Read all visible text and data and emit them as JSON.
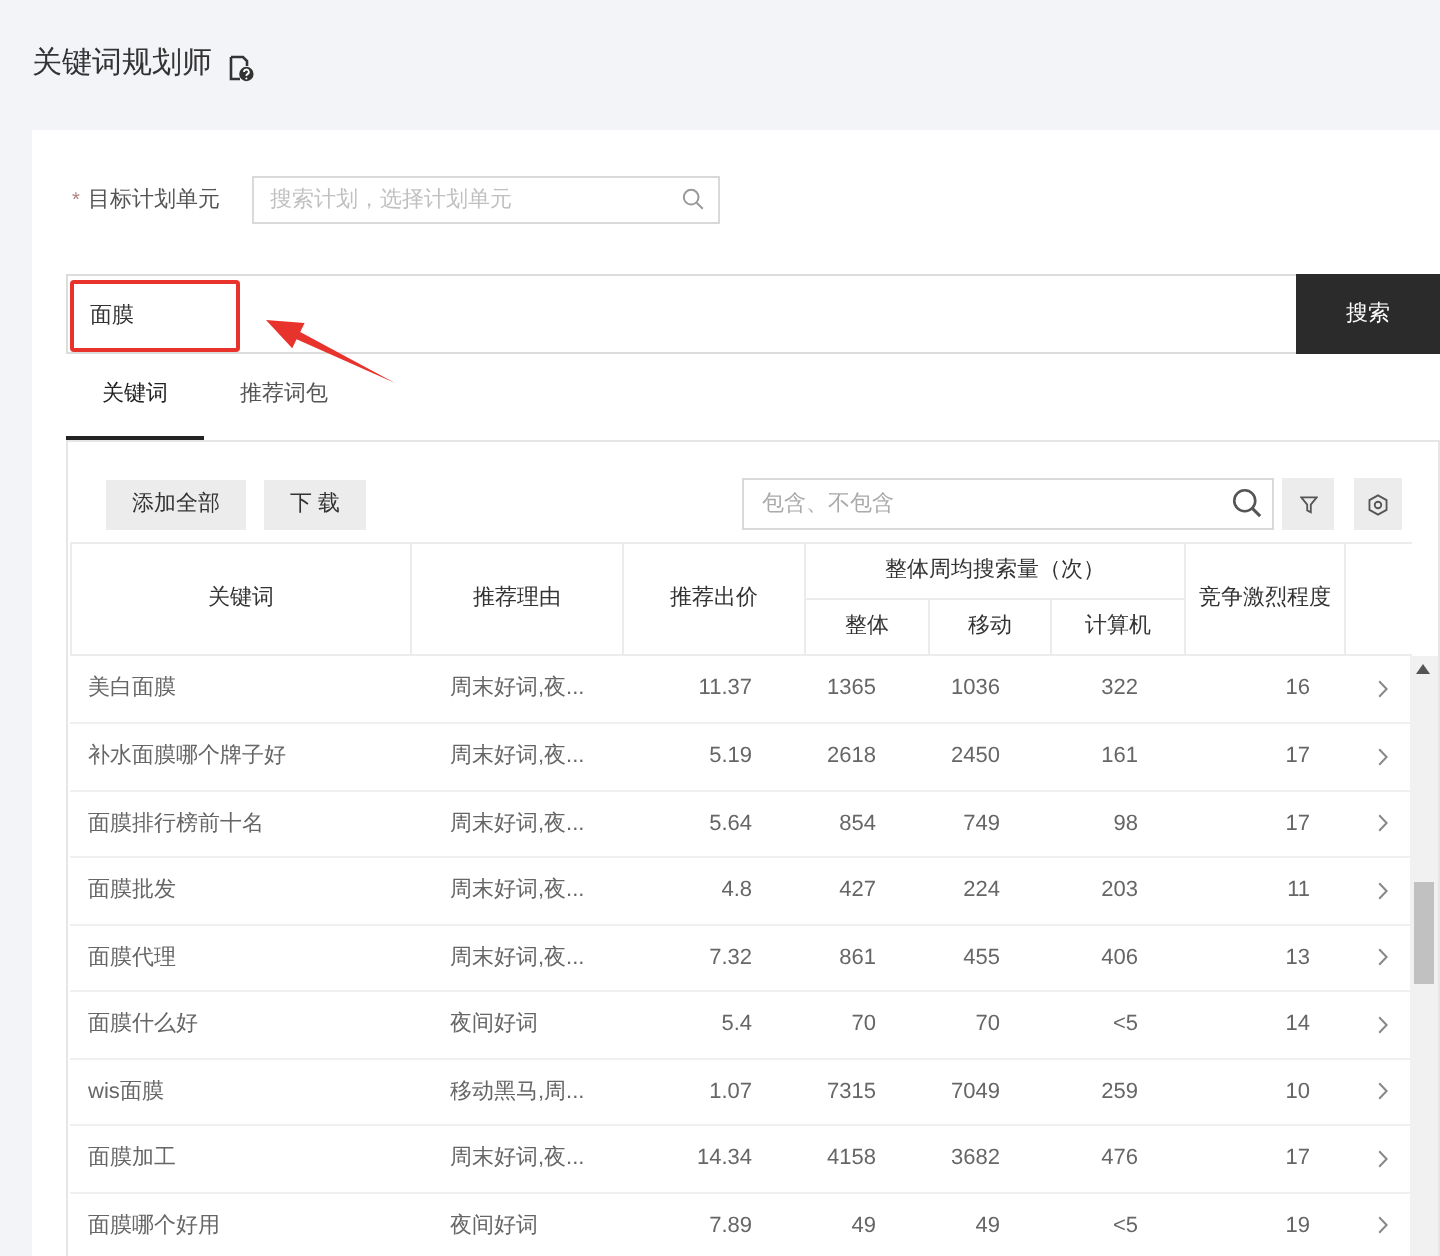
{
  "header": {
    "title": "关键词规划师"
  },
  "plan_unit": {
    "required_mark": "*",
    "label": "目标计划单元",
    "placeholder": "搜索计划，选择计划单元"
  },
  "search": {
    "value": "面膜",
    "button": "搜索"
  },
  "tabs": [
    {
      "label": "关键词",
      "selected": true
    },
    {
      "label": "推荐词包",
      "selected": false
    }
  ],
  "toolbar": {
    "buttons": [
      "添加全部",
      "下 载"
    ],
    "filter": {
      "placeholder": "包含、不包含"
    }
  },
  "table": {
    "columns": [
      {
        "label": "关键词"
      },
      {
        "label": "推荐理由"
      },
      {
        "label": "推荐出价"
      },
      {
        "label": "整体周均搜索量（次）",
        "colspan": 3,
        "children": [
          {
            "label": "整体"
          },
          {
            "label": "移动"
          },
          {
            "label": "计算机"
          }
        ]
      },
      {
        "label": "竞争激烈程度"
      }
    ],
    "rows": [
      {
        "cells": [
          "美白面膜",
          "周末好词,夜...",
          "11.37",
          "1365",
          "1036",
          "322",
          "16"
        ]
      },
      {
        "cells": [
          "补水面膜哪个牌子好",
          "周末好词,夜...",
          "5.19",
          "2618",
          "2450",
          "161",
          "17"
        ]
      },
      {
        "cells": [
          "面膜排行榜前十名",
          "周末好词,夜...",
          "5.64",
          "854",
          "749",
          "98",
          "17"
        ]
      },
      {
        "cells": [
          "面膜批发",
          "周末好词,夜...",
          "4.8",
          "427",
          "224",
          "203",
          "11"
        ]
      },
      {
        "cells": [
          "面膜代理",
          "周末好词,夜...",
          "7.32",
          "861",
          "455",
          "406",
          "13"
        ]
      },
      {
        "cells": [
          "面膜什么好",
          "夜间好词",
          "5.4",
          "70",
          "70",
          "<5",
          "14"
        ]
      },
      {
        "cells": [
          "wis面膜",
          "移动黑马,周...",
          "1.07",
          "7315",
          "7049",
          "259",
          "10"
        ]
      },
      {
        "cells": [
          "面膜加工",
          "周末好词,夜...",
          "14.34",
          "4158",
          "3682",
          "476",
          "17"
        ]
      },
      {
        "cells": [
          "面膜哪个好用",
          "夜间好词",
          "7.89",
          "49",
          "49",
          "<5",
          "19"
        ]
      }
    ]
  }
}
